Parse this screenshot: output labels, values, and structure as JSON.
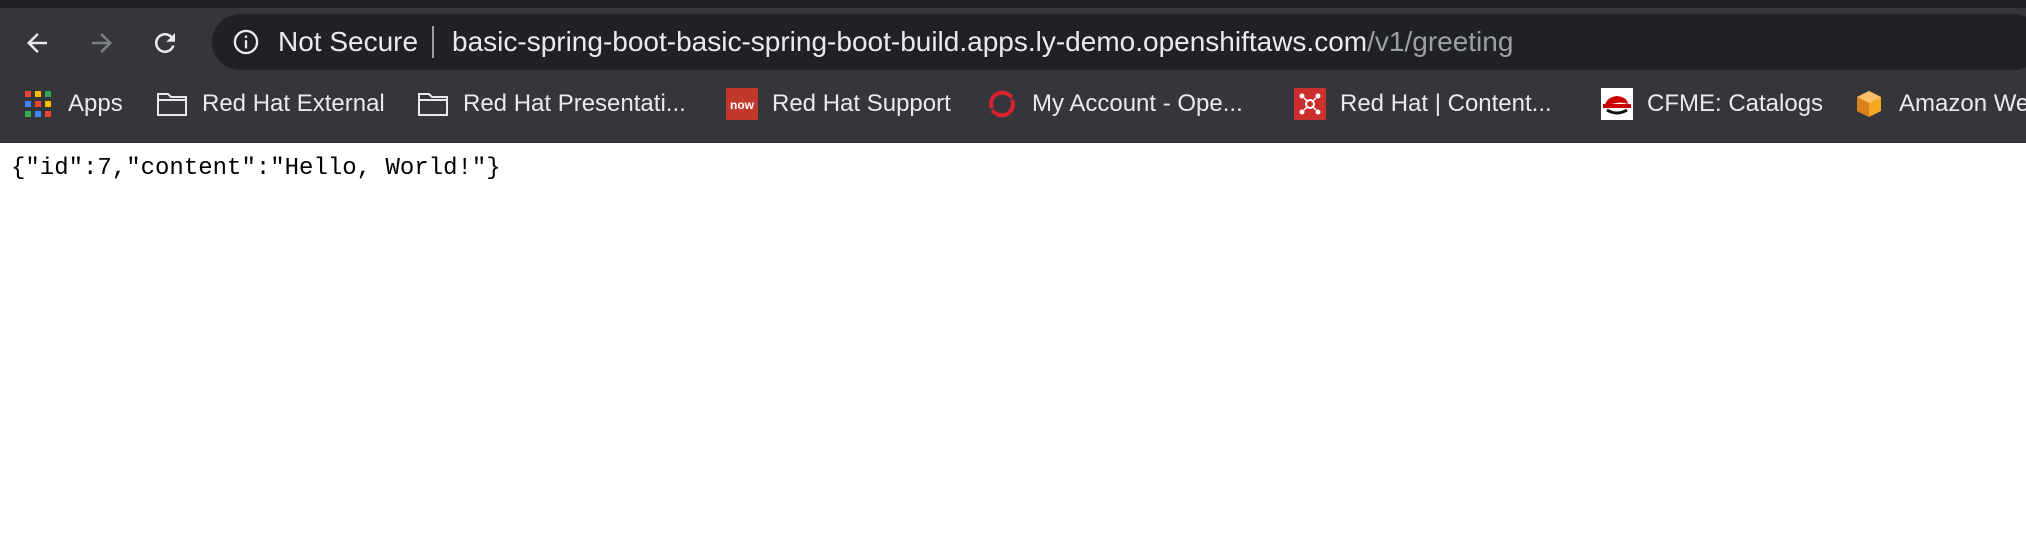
{
  "toolbar": {
    "back_icon": "arrow-left-icon",
    "forward_icon": "arrow-right-icon",
    "reload_icon": "reload-icon"
  },
  "omnibox": {
    "security_icon": "info-icon",
    "security_label": "Not Secure",
    "url_host": "basic-spring-boot-basic-spring-boot-build.apps.ly-demo.openshiftaws.com",
    "url_path": "/v1/greeting"
  },
  "bookmarks": [
    {
      "label": "Apps",
      "icon": "apps-grid-icon"
    },
    {
      "label": "Red Hat External",
      "icon": "folder-icon"
    },
    {
      "label": "Red Hat Presentati...",
      "icon": "folder-icon"
    },
    {
      "label": "Red Hat Support",
      "icon": "now-logo-icon",
      "icon_text": "now"
    },
    {
      "label": "My Account - Ope...",
      "icon": "openshift-icon"
    },
    {
      "label": "Red Hat | Content...",
      "icon": "network-nodes-icon"
    },
    {
      "label": "CFME: Catalogs",
      "icon": "redhat-shadowman-icon"
    },
    {
      "label": "Amazon We",
      "icon": "aws-box-icon"
    }
  ],
  "page": {
    "body_text": "{\"id\":7,\"content\":\"Hello, World!\"}"
  },
  "colors": {
    "chrome_bg": "#35363a",
    "omnibox_bg": "#202124",
    "text_light": "#e8eaed",
    "text_muted": "#9aa0a6"
  }
}
